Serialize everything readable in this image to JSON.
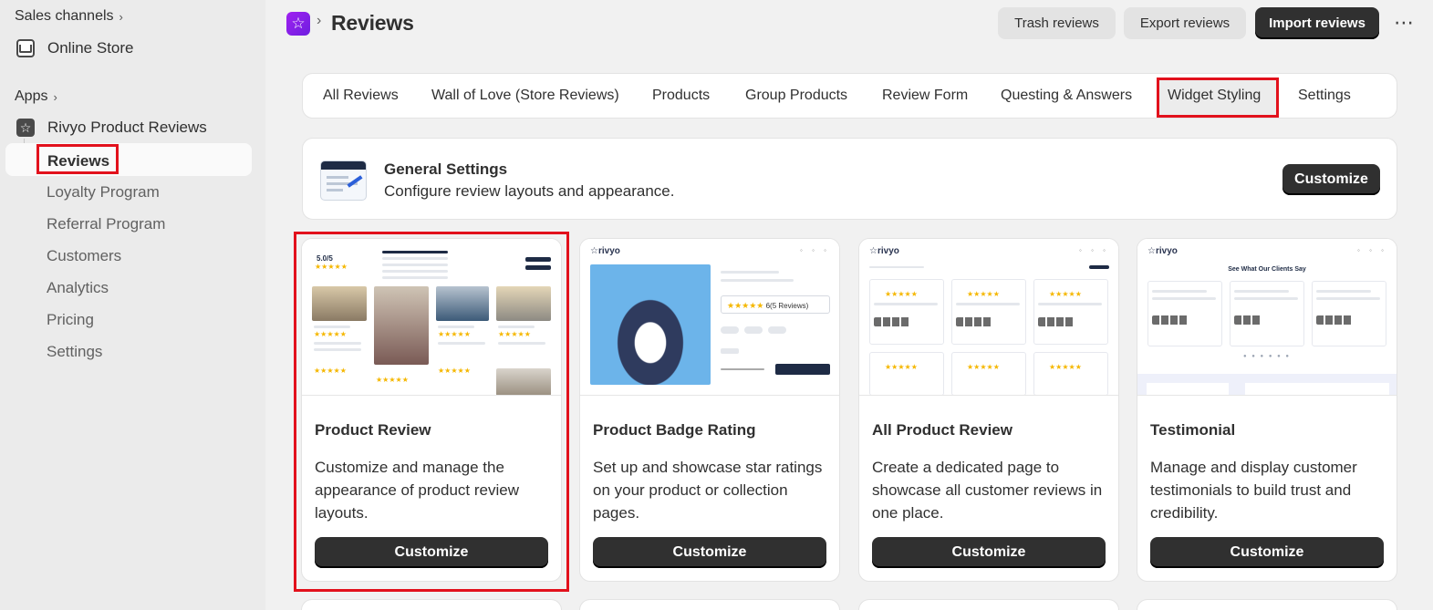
{
  "sidebar": {
    "sales_channels": "Sales channels",
    "online_store": "Online Store",
    "apps": "Apps",
    "app_name": "Rivyo Product Reviews",
    "items": [
      {
        "label": "Reviews"
      },
      {
        "label": "Loyalty Program"
      },
      {
        "label": "Referral Program"
      },
      {
        "label": "Customers"
      },
      {
        "label": "Analytics"
      },
      {
        "label": "Pricing"
      },
      {
        "label": "Settings"
      }
    ]
  },
  "header": {
    "title": "Reviews",
    "trash": "Trash reviews",
    "export": "Export reviews",
    "import": "Import reviews"
  },
  "tabs": [
    {
      "label": "All Reviews"
    },
    {
      "label": "Wall of Love (Store Reviews)"
    },
    {
      "label": "Products"
    },
    {
      "label": "Group Products"
    },
    {
      "label": "Review Form"
    },
    {
      "label": "Questing & Answers"
    },
    {
      "label": "Widget Styling"
    },
    {
      "label": "Settings"
    }
  ],
  "general": {
    "title": "General Settings",
    "subtitle": "Configure review layouts and appearance.",
    "button": "Customize"
  },
  "cards": [
    {
      "title": "Product Review",
      "desc": "Customize and manage the appearance of product review layouts.",
      "button": "Customize",
      "preview": {
        "rating": "5.0/5"
      }
    },
    {
      "title": "Product Badge Rating",
      "desc": "Set up and showcase star ratings on your product or collection pages.",
      "button": "Customize",
      "preview": {
        "brand": "rivyo",
        "badge": "6(5 Reviews)"
      }
    },
    {
      "title": "All Product Review",
      "desc": "Create a dedicated page to showcase all customer reviews in one place.",
      "button": "Customize",
      "preview": {
        "brand": "rivyo"
      }
    },
    {
      "title": "Testimonial",
      "desc": "Manage and display customer testimonials to build trust and credibility.",
      "button": "Customize",
      "preview": {
        "brand": "rivyo",
        "heading": "See What Our Clients Say"
      }
    }
  ],
  "colors": {
    "highlight": "#e2111c",
    "primary_button": "#303030",
    "app_logo": "#8a1fe8",
    "star": "#f5b700"
  },
  "icons": [
    "chevron-right-icon",
    "store-icon",
    "rivyo-app-icon",
    "star-logo-icon",
    "more-icon"
  ]
}
